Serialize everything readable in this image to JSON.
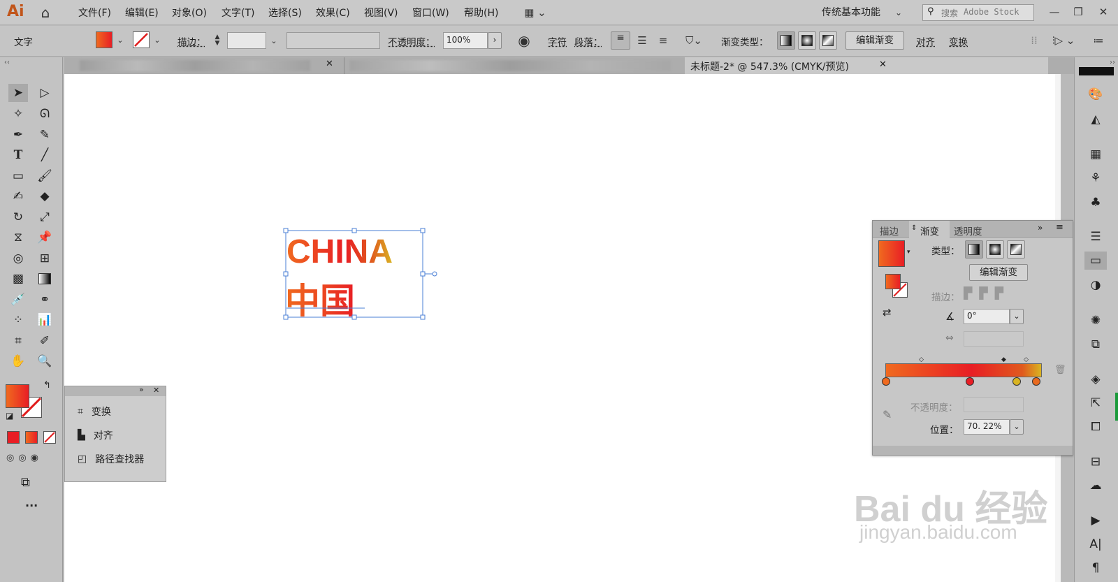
{
  "app": {
    "logo": "Ai"
  },
  "menus": [
    "文件(F)",
    "编辑(E)",
    "对象(O)",
    "文字(T)",
    "选择(S)",
    "效果(C)",
    "视图(V)",
    "窗口(W)",
    "帮助(H)"
  ],
  "workspace": "传统基本功能",
  "search": {
    "label": "搜索",
    "placeholder": "Adobe Stock"
  },
  "control": {
    "type_label": "文字",
    "stroke_label": "描边：",
    "opacity_label": "不透明度：",
    "opacity_value": "100%",
    "char_label": "字符",
    "para_label": "段落：",
    "gradient_type_label": "渐变类型：",
    "edit_gradient": "编辑渐变",
    "align": "对齐",
    "transform": "变换"
  },
  "tabs": {
    "active": "未标题-2* @ 547.3% (CMYK/预览)"
  },
  "artwork": {
    "line1": "CHINA",
    "line2": "中国"
  },
  "colors": {
    "grad_start": "#f06a1f",
    "grad_mid": "#e81e25",
    "grad_end": "#d9b422",
    "selection": "#4a7fd6",
    "ui_bg": "#c3c3c3",
    "canvas": "#ffffff"
  },
  "gradient_panel": {
    "tabs": [
      "描边",
      "渐变",
      "透明度"
    ],
    "type_label": "类型：",
    "edit_button": "编辑渐变",
    "stroke_label": "描边：",
    "angle_value": "0°",
    "opacity_label": "不透明度：",
    "position_label": "位置：",
    "position_value": "70. 22%"
  },
  "mini_panel": {
    "items": [
      "变换",
      "对齐",
      "路径查找器"
    ]
  },
  "watermark": {
    "line1": "Bai du 经验",
    "line2": "jingyan.baidu.com"
  }
}
